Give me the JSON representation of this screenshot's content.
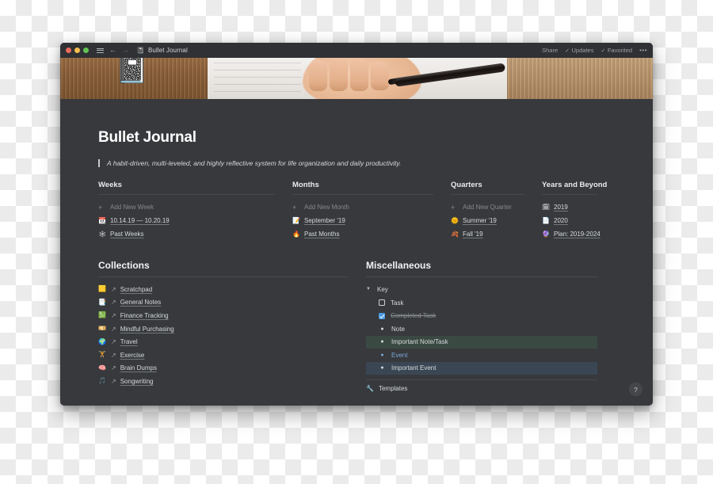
{
  "window": {
    "titlebar": {
      "traffic_lights": [
        "close",
        "minimize",
        "maximize"
      ],
      "menu_icon": "hamburger-icon",
      "back_icon": "←",
      "forward_icon": "→",
      "doc_emoji": "📓",
      "doc_title": "Bullet Journal",
      "share_label": "Share",
      "updates_label": "Updates",
      "favorited_label": "Favorited",
      "check_glyph": "✓",
      "more_glyph": "•••"
    }
  },
  "page": {
    "icon_emoji": "📓",
    "title": "Bullet Journal",
    "subtitle": "A habit-driven, multi-leveled, and highly reflective system for life organization and daily productivity."
  },
  "columns": [
    {
      "title": "Weeks",
      "add_label": "Add New Week",
      "items": [
        {
          "emoji": "📆",
          "label": "10.14.19 — 10.20.19"
        },
        {
          "emoji": "🕸",
          "label": "Past Weeks"
        }
      ]
    },
    {
      "title": "Months",
      "add_label": "Add New Month",
      "items": [
        {
          "emoji": "📝",
          "label": "September '19"
        },
        {
          "emoji": "🔥",
          "label": "Past Months"
        }
      ]
    },
    {
      "title": "Quarters",
      "add_label": "Add New Quarter",
      "items": [
        {
          "emoji": "🌞",
          "label": "Summer '19"
        },
        {
          "emoji": "🍂",
          "label": "Fall '19"
        }
      ]
    },
    {
      "title": "Years and Beyond",
      "add_label": "",
      "items": [
        {
          "emoji": "🗓",
          "label": "2019"
        },
        {
          "emoji": "📄",
          "label": "2020"
        },
        {
          "emoji": "🔮",
          "label": "Plan: 2019-2024"
        }
      ]
    }
  ],
  "collections": {
    "title": "Collections",
    "arrow_glyph": "↗",
    "items": [
      {
        "emoji": "🟨",
        "label": "Scratchpad"
      },
      {
        "emoji": "📑",
        "label": "General Notes"
      },
      {
        "emoji": "💹",
        "label": "Finance Tracking"
      },
      {
        "emoji": "💴",
        "label": "Mindful Purchasing"
      },
      {
        "emoji": "🌍",
        "label": "Travel"
      },
      {
        "emoji": "🏋",
        "label": "Exercise"
      },
      {
        "emoji": "🧠",
        "label": "Brain Dumps"
      },
      {
        "emoji": "🎵",
        "label": "Songwriting"
      }
    ]
  },
  "miscellaneous": {
    "title": "Miscellaneous",
    "key": {
      "toggle_glyph": "▼",
      "label": "Key",
      "items": [
        {
          "type": "checkbox",
          "checked": false,
          "label": "Task",
          "highlight": "none"
        },
        {
          "type": "checkbox",
          "checked": true,
          "label": "Completed Task",
          "highlight": "none"
        },
        {
          "type": "bullet",
          "label": "Note",
          "highlight": "none"
        },
        {
          "type": "bullet",
          "label": "Important Note/Task",
          "highlight": "green"
        },
        {
          "type": "bullet",
          "label": "Event",
          "highlight": "none"
        },
        {
          "type": "bullet",
          "label": "Important Event",
          "highlight": "blue"
        }
      ]
    },
    "templates": {
      "emoji": "🔧",
      "label": "Templates"
    }
  },
  "help": {
    "glyph": "?"
  },
  "colors": {
    "window_bg": "#37393c",
    "titlebar_bg": "#2f3134",
    "accent_blue": "#4a9ae1",
    "highlight_green": "#3a4a43",
    "highlight_blue": "#3a4654"
  }
}
